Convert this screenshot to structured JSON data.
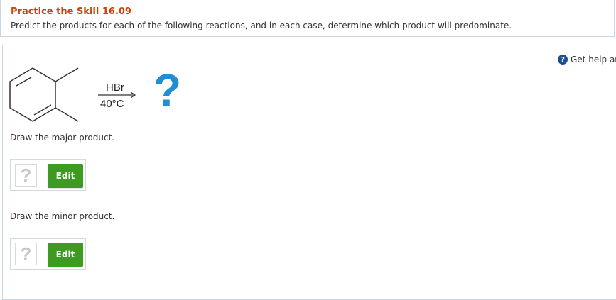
{
  "header": {
    "title": "Practice the Skill 16.09",
    "instructions": "Predict the products for each of the following reactions, and in each case, determine which product will predominate."
  },
  "help": {
    "icon": "help-icon",
    "icon_glyph": "?",
    "label": "Get help ar"
  },
  "reaction": {
    "reagent_top": "HBr",
    "reagent_bottom": "40°C",
    "unknown_product": "?"
  },
  "answers": [
    {
      "prompt": "Draw the major product.",
      "placeholder": "?",
      "edit_label": "Edit"
    },
    {
      "prompt": "Draw the minor product.",
      "placeholder": "?",
      "edit_label": "Edit"
    }
  ],
  "colors": {
    "title": "#c7430f",
    "edit_button": "#3c9b20",
    "question_mark": "#1e8fd5",
    "help_icon": "#1d4e8f"
  }
}
